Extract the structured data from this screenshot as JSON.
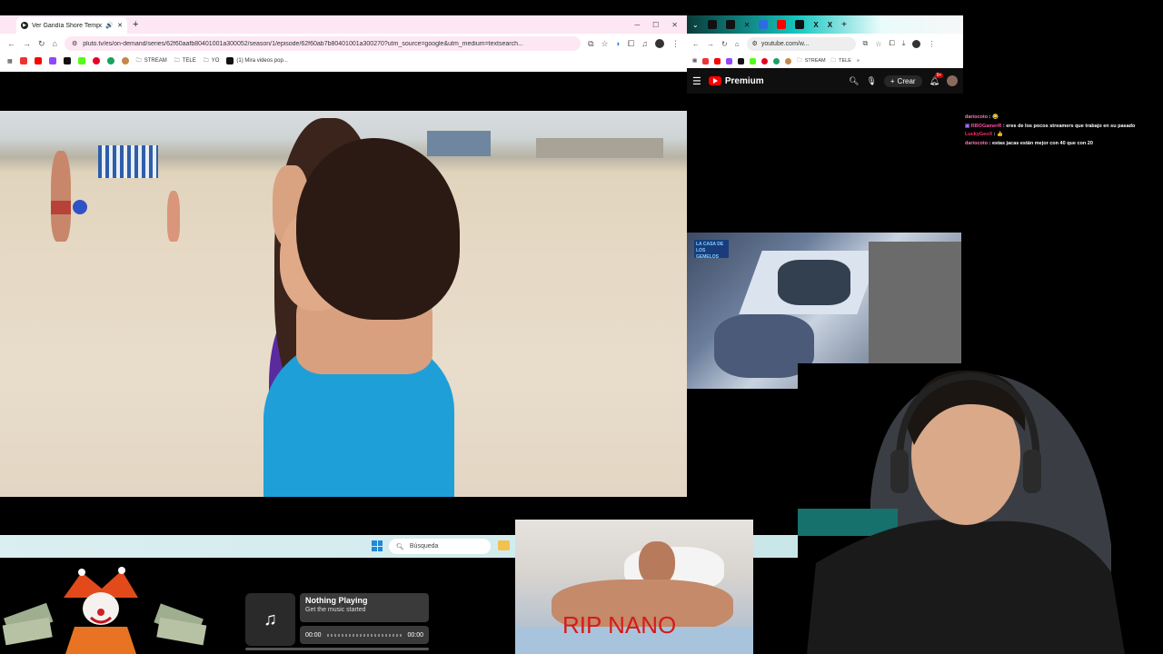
{
  "left_browser": {
    "tab_title": "Ver Gandía Shore Tempora...",
    "url": "pluto.tv/es/on-demand/series/62f60aafb80401001a300052/season/1/episode/62f60ab7b80401001a300270?utm_source=google&utm_medium=textsearch...",
    "bookmarks": [
      "STREAM",
      "TELE",
      "YO",
      "(1) Mira videos pop..."
    ]
  },
  "right_browser": {
    "url": "youtube.com/w...",
    "bookmarks": [
      "STREAM",
      "TELE"
    ],
    "yt_logo_text": "Premium",
    "create_label": "Crear",
    "notif_badge": "9+"
  },
  "chat": [
    {
      "user": "dariocoto",
      "color": "#ff7ab6",
      "text": "😂"
    },
    {
      "user": "RBOGamerR",
      "color": "#ff4da6",
      "text": "eres de los pocos streamers que trabajo en su pasado"
    },
    {
      "user": "LuckyGeoX",
      "color": "#ff2e6c",
      "text": "👍"
    },
    {
      "user": "dariocoto",
      "color": "#ff7ab6",
      "text": "estas jacas están mejor con 40 que con 20"
    }
  ],
  "taskbar": {
    "search_placeholder": "Búsqueda"
  },
  "music": {
    "title": "Nothing Playing",
    "subtitle": "Get the music started",
    "time_start": "00:00",
    "time_end": "00:00"
  },
  "rip_caption": "RIP NANO"
}
